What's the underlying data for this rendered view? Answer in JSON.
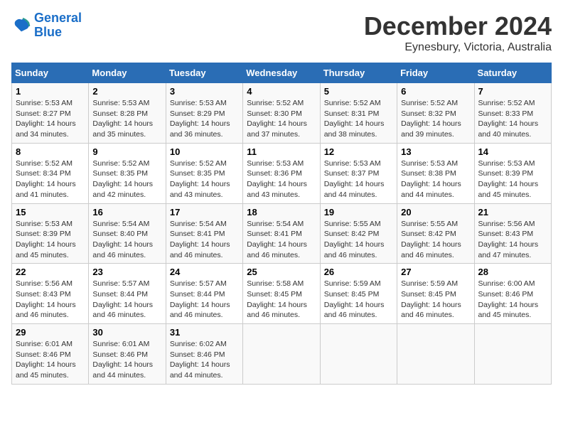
{
  "logo": {
    "line1": "General",
    "line2": "Blue"
  },
  "title": "December 2024",
  "subtitle": "Eynesbury, Victoria, Australia",
  "days_header": [
    "Sunday",
    "Monday",
    "Tuesday",
    "Wednesday",
    "Thursday",
    "Friday",
    "Saturday"
  ],
  "weeks": [
    [
      {
        "day": "1",
        "sunrise": "5:53 AM",
        "sunset": "8:27 PM",
        "daylight": "14 hours and 34 minutes."
      },
      {
        "day": "2",
        "sunrise": "5:53 AM",
        "sunset": "8:28 PM",
        "daylight": "14 hours and 35 minutes."
      },
      {
        "day": "3",
        "sunrise": "5:53 AM",
        "sunset": "8:29 PM",
        "daylight": "14 hours and 36 minutes."
      },
      {
        "day": "4",
        "sunrise": "5:52 AM",
        "sunset": "8:30 PM",
        "daylight": "14 hours and 37 minutes."
      },
      {
        "day": "5",
        "sunrise": "5:52 AM",
        "sunset": "8:31 PM",
        "daylight": "14 hours and 38 minutes."
      },
      {
        "day": "6",
        "sunrise": "5:52 AM",
        "sunset": "8:32 PM",
        "daylight": "14 hours and 39 minutes."
      },
      {
        "day": "7",
        "sunrise": "5:52 AM",
        "sunset": "8:33 PM",
        "daylight": "14 hours and 40 minutes."
      }
    ],
    [
      {
        "day": "8",
        "sunrise": "5:52 AM",
        "sunset": "8:34 PM",
        "daylight": "14 hours and 41 minutes."
      },
      {
        "day": "9",
        "sunrise": "5:52 AM",
        "sunset": "8:35 PM",
        "daylight": "14 hours and 42 minutes."
      },
      {
        "day": "10",
        "sunrise": "5:52 AM",
        "sunset": "8:35 PM",
        "daylight": "14 hours and 43 minutes."
      },
      {
        "day": "11",
        "sunrise": "5:53 AM",
        "sunset": "8:36 PM",
        "daylight": "14 hours and 43 minutes."
      },
      {
        "day": "12",
        "sunrise": "5:53 AM",
        "sunset": "8:37 PM",
        "daylight": "14 hours and 44 minutes."
      },
      {
        "day": "13",
        "sunrise": "5:53 AM",
        "sunset": "8:38 PM",
        "daylight": "14 hours and 44 minutes."
      },
      {
        "day": "14",
        "sunrise": "5:53 AM",
        "sunset": "8:39 PM",
        "daylight": "14 hours and 45 minutes."
      }
    ],
    [
      {
        "day": "15",
        "sunrise": "5:53 AM",
        "sunset": "8:39 PM",
        "daylight": "14 hours and 45 minutes."
      },
      {
        "day": "16",
        "sunrise": "5:54 AM",
        "sunset": "8:40 PM",
        "daylight": "14 hours and 46 minutes."
      },
      {
        "day": "17",
        "sunrise": "5:54 AM",
        "sunset": "8:41 PM",
        "daylight": "14 hours and 46 minutes."
      },
      {
        "day": "18",
        "sunrise": "5:54 AM",
        "sunset": "8:41 PM",
        "daylight": "14 hours and 46 minutes."
      },
      {
        "day": "19",
        "sunrise": "5:55 AM",
        "sunset": "8:42 PM",
        "daylight": "14 hours and 46 minutes."
      },
      {
        "day": "20",
        "sunrise": "5:55 AM",
        "sunset": "8:42 PM",
        "daylight": "14 hours and 46 minutes."
      },
      {
        "day": "21",
        "sunrise": "5:56 AM",
        "sunset": "8:43 PM",
        "daylight": "14 hours and 47 minutes."
      }
    ],
    [
      {
        "day": "22",
        "sunrise": "5:56 AM",
        "sunset": "8:43 PM",
        "daylight": "14 hours and 46 minutes."
      },
      {
        "day": "23",
        "sunrise": "5:57 AM",
        "sunset": "8:44 PM",
        "daylight": "14 hours and 46 minutes."
      },
      {
        "day": "24",
        "sunrise": "5:57 AM",
        "sunset": "8:44 PM",
        "daylight": "14 hours and 46 minutes."
      },
      {
        "day": "25",
        "sunrise": "5:58 AM",
        "sunset": "8:45 PM",
        "daylight": "14 hours and 46 minutes."
      },
      {
        "day": "26",
        "sunrise": "5:59 AM",
        "sunset": "8:45 PM",
        "daylight": "14 hours and 46 minutes."
      },
      {
        "day": "27",
        "sunrise": "5:59 AM",
        "sunset": "8:45 PM",
        "daylight": "14 hours and 46 minutes."
      },
      {
        "day": "28",
        "sunrise": "6:00 AM",
        "sunset": "8:46 PM",
        "daylight": "14 hours and 45 minutes."
      }
    ],
    [
      {
        "day": "29",
        "sunrise": "6:01 AM",
        "sunset": "8:46 PM",
        "daylight": "14 hours and 45 minutes."
      },
      {
        "day": "30",
        "sunrise": "6:01 AM",
        "sunset": "8:46 PM",
        "daylight": "14 hours and 44 minutes."
      },
      {
        "day": "31",
        "sunrise": "6:02 AM",
        "sunset": "8:46 PM",
        "daylight": "14 hours and 44 minutes."
      },
      null,
      null,
      null,
      null
    ]
  ]
}
